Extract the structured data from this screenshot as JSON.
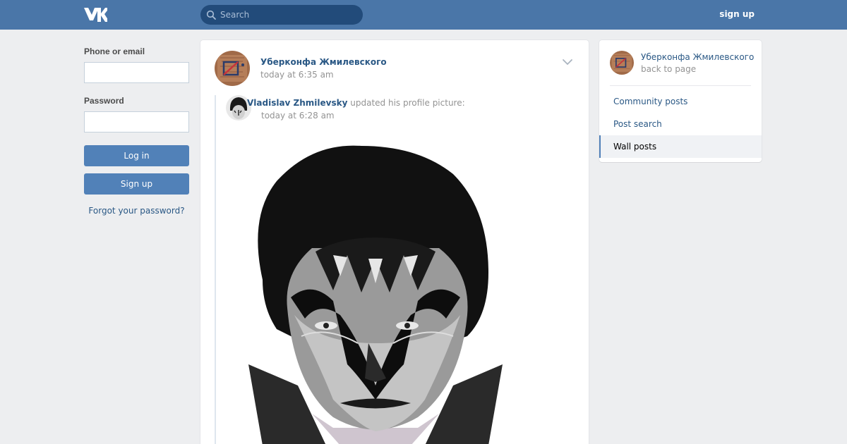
{
  "header": {
    "logo_text": "VK",
    "search_placeholder": "Search",
    "signup_label": "sign up"
  },
  "login": {
    "phone_label": "Phone or email",
    "password_label": "Password",
    "login_button": "Log in",
    "signup_button": "Sign up",
    "forgot_link": "Forgot your password?"
  },
  "post": {
    "author": "Уберконфа Жмилевского",
    "time": "today at 6:35 am",
    "repost": {
      "author": "Vladislav Zhmilevsky",
      "action": " updated his profile picture:",
      "time": "today at 6:28 am"
    }
  },
  "sidebar": {
    "community_name": "Уберконфа Жмилевского",
    "back_label": "back to page",
    "items": [
      {
        "label": "Community posts",
        "active": false
      },
      {
        "label": "Post search",
        "active": false
      },
      {
        "label": "Wall posts",
        "active": true
      }
    ]
  },
  "colors": {
    "header_bg": "#4a76a8",
    "link": "#2a5885",
    "button": "#5181b8",
    "page_bg": "#edeef0"
  }
}
